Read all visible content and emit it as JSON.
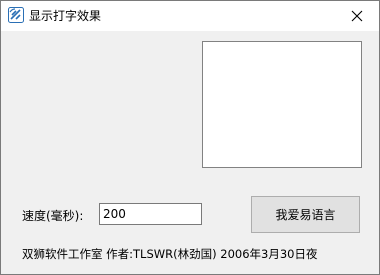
{
  "window": {
    "title": "显示打字效果",
    "icon": "app-logo-icon",
    "close_glyph": "✕"
  },
  "form": {
    "speed_label": "速度(毫秒):",
    "speed_value": "200",
    "button_label": "我爱易语言"
  },
  "footer": {
    "credit": "双狮软件工作室 作者:TLSWR(林劲国) 2006年3月30日夜"
  },
  "colors": {
    "window_bg": "#f0f0f0",
    "titlebar_bg": "#ffffff",
    "icon_blue": "#2a6fb5"
  }
}
